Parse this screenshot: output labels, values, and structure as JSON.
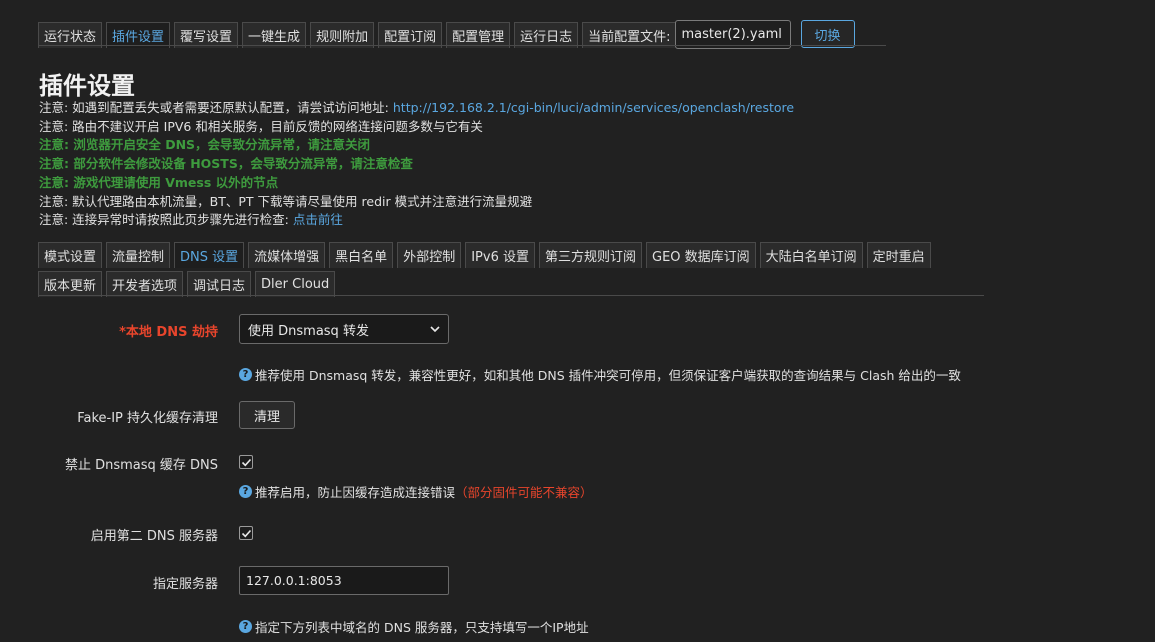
{
  "top_tabs": [
    {
      "label": "运行状态"
    },
    {
      "label": "插件设置"
    },
    {
      "label": "覆写设置"
    },
    {
      "label": "一键生成"
    },
    {
      "label": "规则附加"
    },
    {
      "label": "配置订阅"
    },
    {
      "label": "配置管理"
    },
    {
      "label": "运行日志"
    }
  ],
  "config_file": {
    "label": "当前配置文件:",
    "selected": "master(2).yaml",
    "switch_label": "切换"
  },
  "page_title": "插件设置",
  "notes": [
    {
      "text": "注意: 如遇到配置丢失或者需要还原默认配置，请尝试访问地址: ",
      "link": "http://192.168.2.1/cgi-bin/luci/admin/services/openclash/restore"
    },
    {
      "text": "注意: 路由不建议开启 IPV6 和相关服务，目前反馈的网络连接问题多数与它有关"
    },
    {
      "text": "注意: 浏览器开启安全 DNS，会导致分流异常，请注意关闭"
    },
    {
      "text": "注意: 部分软件会修改设备 HOSTS，会导致分流异常，请注意检查"
    },
    {
      "text": "注意: 游戏代理请使用 Vmess 以外的节点"
    },
    {
      "text": "注意: 默认代理路由本机流量，BT、PT 下载等请尽量使用 redir 模式并注意进行流量规避"
    },
    {
      "text": "注意: 连接异常时请按照此页步骤先进行检查: ",
      "link": "点击前往"
    }
  ],
  "sub_tabs_row1": [
    {
      "label": "模式设置"
    },
    {
      "label": "流量控制"
    },
    {
      "label": "DNS 设置"
    },
    {
      "label": "流媒体增强"
    },
    {
      "label": "黑白名单"
    },
    {
      "label": "外部控制"
    },
    {
      "label": "IPv6 设置"
    },
    {
      "label": "第三方规则订阅"
    },
    {
      "label": "GEO 数据库订阅"
    },
    {
      "label": "大陆白名单订阅"
    },
    {
      "label": "定时重启"
    }
  ],
  "sub_tabs_row2": [
    {
      "label": "版本更新"
    },
    {
      "label": "开发者选项"
    },
    {
      "label": "调试日志"
    },
    {
      "label": "Dler Cloud"
    }
  ],
  "form": {
    "local_dns_hijack": {
      "label": "*本地 DNS 劫持",
      "selected": "使用 Dnsmasq 转发",
      "help": "推荐使用 Dnsmasq 转发，兼容性更好，如和其他 DNS 插件冲突可停用，但须保证客户端获取的查询结果与 Clash 给出的一致"
    },
    "fakeip_cache": {
      "label": "Fake-IP 持久化缓存清理",
      "button": "清理"
    },
    "disable_dnsmasq_cache": {
      "label": "禁止 Dnsmasq 缓存 DNS",
      "checked": true,
      "help": "推荐启用，防止因缓存造成连接错误",
      "warn": "（部分固件可能不兼容）"
    },
    "second_dns": {
      "label": "启用第二 DNS 服务器",
      "checked": true
    },
    "specify_server": {
      "label": "指定服务器",
      "value": "127.0.0.1:8053",
      "help": "指定下方列表中域名的 DNS 服务器，只支持填写一个IP地址"
    }
  },
  "colors": {
    "accent": "#5aa7e0",
    "green_note": "#3e9b3e",
    "required": "#e8452c",
    "background": "#212121"
  }
}
